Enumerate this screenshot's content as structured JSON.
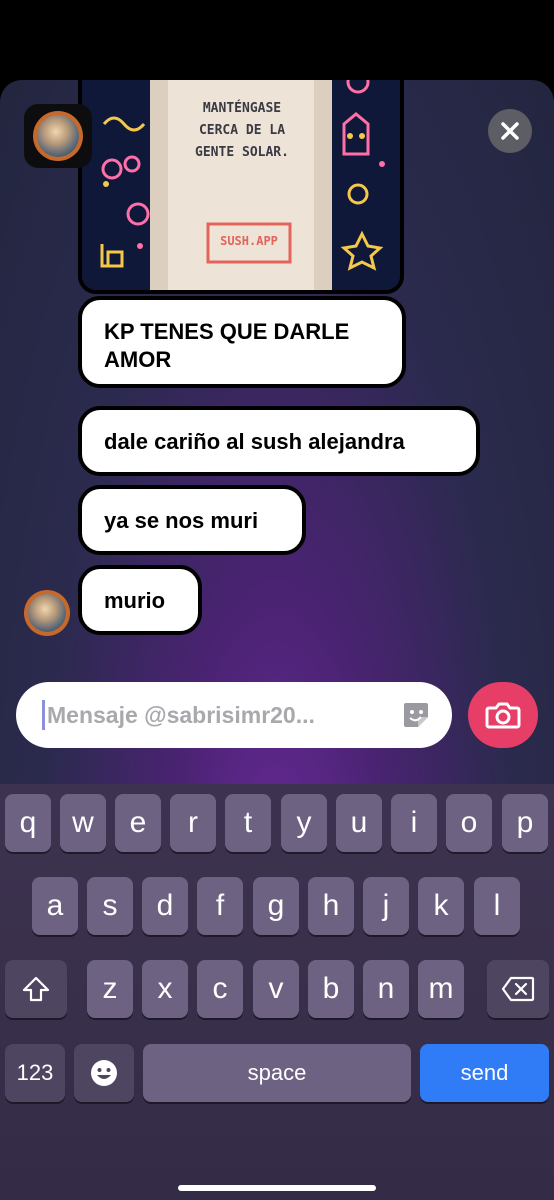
{
  "media": {
    "banner_line1": "MANTÉNGASE",
    "banner_line2": "CERCA DE LA",
    "banner_line3": "GENTE SOLAR.",
    "stamp": "SUSH.APP"
  },
  "messages": [
    {
      "line1": "KP TENES QUE DARLE",
      "line2": "AMOR"
    },
    {
      "text": "dale cariño al sush alejandra"
    },
    {
      "text": "ya se nos muri"
    },
    {
      "text": "murio"
    }
  ],
  "composer": {
    "placeholder": "Mensaje @sabrisimr20..."
  },
  "keyboard": {
    "row1": [
      "q",
      "w",
      "e",
      "r",
      "t",
      "y",
      "u",
      "i",
      "o",
      "p"
    ],
    "row2": [
      "a",
      "s",
      "d",
      "f",
      "g",
      "h",
      "j",
      "k",
      "l"
    ],
    "row3": [
      "z",
      "x",
      "c",
      "v",
      "b",
      "n",
      "m"
    ],
    "numbers_label": "123",
    "space_label": "space",
    "send_label": "send"
  },
  "colors": {
    "camera_button": "#e63e66",
    "send_key": "#2f7cf6",
    "key": "#6e6282"
  }
}
